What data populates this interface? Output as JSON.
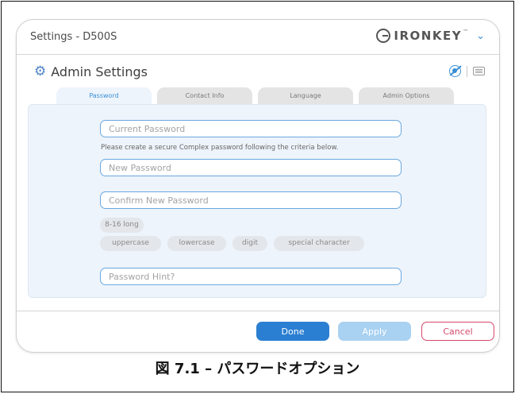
{
  "window": {
    "title": "Settings - D500S",
    "brand": "IRONKEY",
    "brand_tm": "™"
  },
  "section": {
    "title": "Admin Settings"
  },
  "icons": {
    "gear": "gear-icon",
    "eye": "eye-slash-icon",
    "keyboard": "keyboard-icon",
    "chevron": "chevron-down-icon"
  },
  "tabs": [
    {
      "label": "Password",
      "active": true
    },
    {
      "label": "Contact Info",
      "active": false
    },
    {
      "label": "Language",
      "active": false
    },
    {
      "label": "Admin Options",
      "active": false
    }
  ],
  "form": {
    "current_password_placeholder": "Current Password",
    "criteria_note": "Please create a secure Complex password following the criteria below.",
    "new_password_placeholder": "New Password",
    "confirm_password_placeholder": "Confirm New Password",
    "hint_placeholder": "Password Hint?"
  },
  "criteria": [
    "8-16 long",
    "uppercase",
    "lowercase",
    "digit",
    "special character"
  ],
  "buttons": {
    "done": "Done",
    "apply": "Apply",
    "cancel": "Cancel"
  },
  "caption": "図 7.1 – パスワードオプション",
  "colors": {
    "accent": "#2b7fd2",
    "apply_disabled": "#a9d1f1",
    "cancel": "#d64a6c",
    "panel_bg": "#eef4fb"
  }
}
